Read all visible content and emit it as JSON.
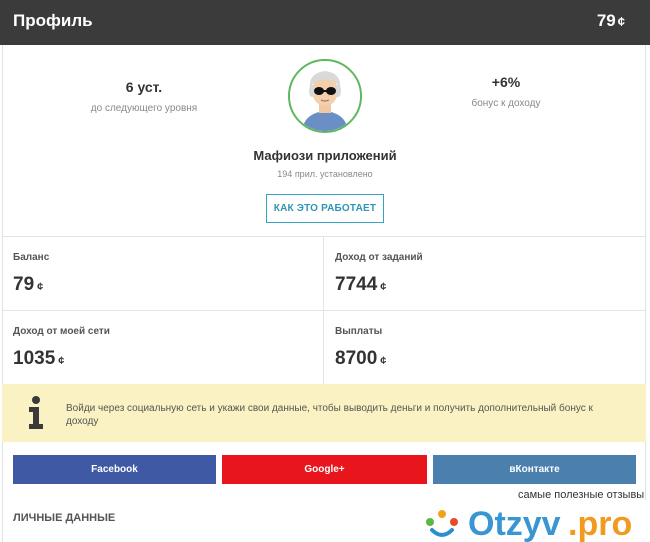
{
  "header": {
    "title": "Профиль",
    "balance": "79",
    "currency": "¢"
  },
  "profile": {
    "left_stat": {
      "value": "6 уст.",
      "label": "до следующего уровня"
    },
    "right_stat": {
      "value": "+6%",
      "label": "бонус к доходу"
    },
    "name": "Мафиози приложений",
    "installs": "194 прил. установлено",
    "how_button": "КАК ЭТО РАБОТАЕТ",
    "avatar_icon": "avatar-icon"
  },
  "stats": [
    {
      "label": "Баланс",
      "value": "79",
      "currency": "¢"
    },
    {
      "label": "Доход от заданий",
      "value": "7744",
      "currency": "¢"
    },
    {
      "label": "Доход от моей сети",
      "value": "1035",
      "currency": "¢"
    },
    {
      "label": "Выплаты",
      "value": "8700",
      "currency": "¢"
    }
  ],
  "info": {
    "icon": "info-icon",
    "text": "Войди через социальную сеть и укажи свои данные, чтобы выводить деньги и получить дополнительный бонус к доходу"
  },
  "social": {
    "facebook": "Facebook",
    "google": "Google+",
    "vk": "вКонтакте"
  },
  "section_title": "ЛИЧНЫЕ ДАННЫЕ",
  "watermark": {
    "tagline": "самые полезные отзывы",
    "logo": "Otzyv.pro"
  },
  "colors": {
    "topbar": "#3b3b3b",
    "accent_green": "#5cb85c",
    "button_border": "#35a4c4",
    "info_bg": "#faf2c2",
    "facebook": "#3f59a4",
    "google": "#e8151c",
    "vk": "#4b7fae"
  }
}
